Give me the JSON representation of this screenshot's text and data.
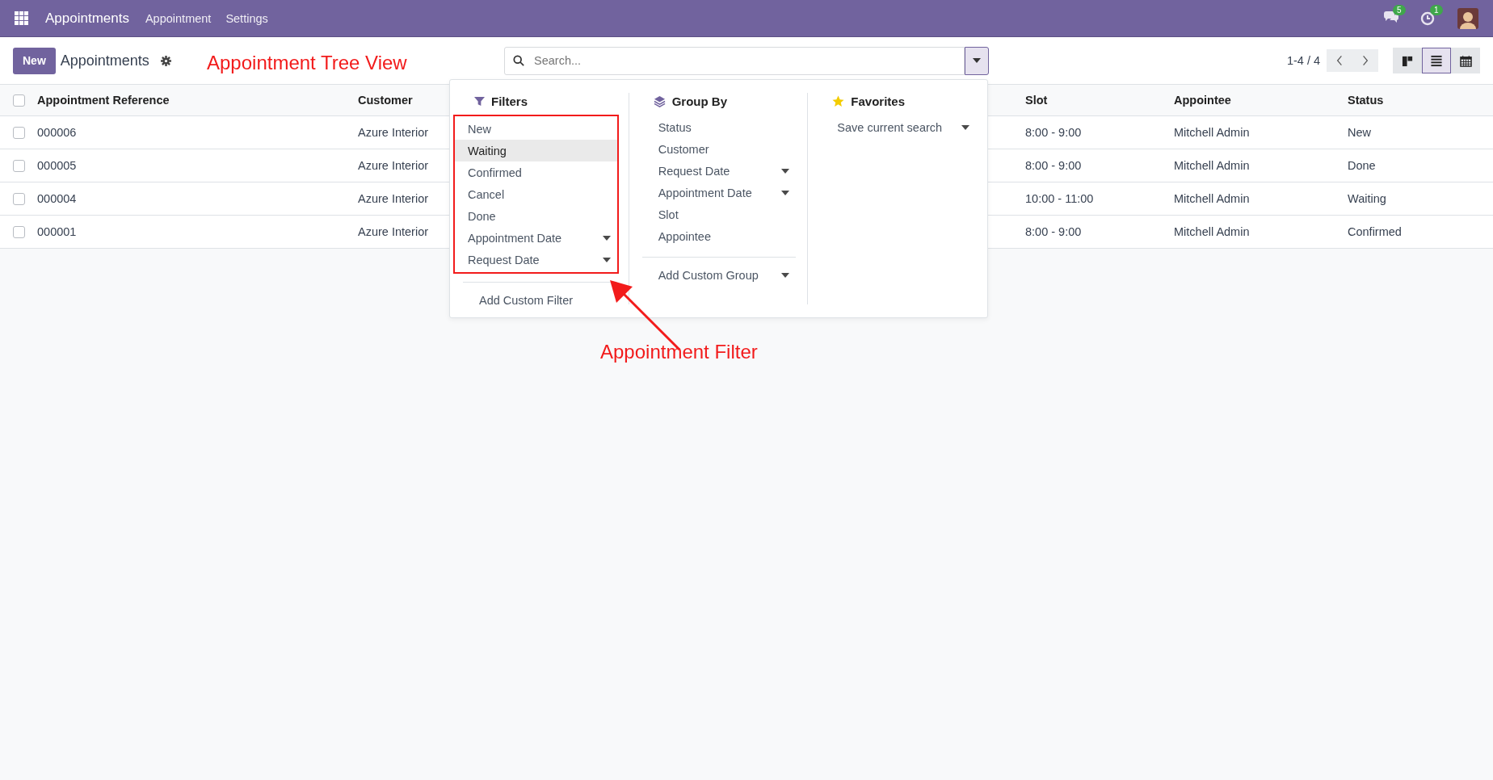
{
  "navbar": {
    "app_title": "Appointments",
    "menus": [
      "Appointment",
      "Settings"
    ],
    "message_count": "5",
    "activity_count": "1"
  },
  "control_panel": {
    "new_button": "New",
    "breadcrumb": "Appointments",
    "search": {
      "placeholder": "Search..."
    },
    "pager": "1-4 / 4",
    "views": [
      {
        "kind": "kanban",
        "selected": false
      },
      {
        "kind": "list",
        "selected": true
      },
      {
        "kind": "calendar",
        "selected": false
      }
    ]
  },
  "table": {
    "header_checked": false,
    "columns": [
      "Appointment Reference",
      "Customer",
      "Slot",
      "Appointee",
      "Status"
    ],
    "rows": [
      {
        "checked": false,
        "cells": [
          "000006",
          "Azure Interior",
          "8:00 - 9:00",
          "Mitchell Admin",
          "New"
        ]
      },
      {
        "checked": false,
        "cells": [
          "000005",
          "Azure Interior",
          "8:00 - 9:00",
          "Mitchell Admin",
          "Done"
        ]
      },
      {
        "checked": false,
        "cells": [
          "000004",
          "Azure Interior",
          "10:00 - 11:00",
          "Mitchell Admin",
          "Waiting"
        ]
      },
      {
        "checked": false,
        "cells": [
          "000001",
          "Azure Interior",
          "8:00 - 9:00",
          "Mitchell Admin",
          "Confirmed"
        ]
      }
    ]
  },
  "search_panel": {
    "filters": {
      "title": "Filters",
      "items": [
        {
          "label": "New",
          "highlighted": false,
          "kind": "option"
        },
        {
          "label": "Waiting",
          "highlighted": true,
          "kind": "option"
        },
        {
          "label": "Confirmed",
          "highlighted": false,
          "kind": "option"
        },
        {
          "label": "Cancel",
          "highlighted": false,
          "kind": "option"
        },
        {
          "label": "Done",
          "highlighted": false,
          "kind": "option"
        },
        {
          "label": "Appointment Date",
          "highlighted": false,
          "kind": "submenu"
        },
        {
          "label": "Request Date",
          "highlighted": false,
          "kind": "submenu"
        }
      ],
      "custom": {
        "label": "Add Custom Filter",
        "kind": "option"
      }
    },
    "group_by": {
      "title": "Group By",
      "items": [
        {
          "label": "Status",
          "highlighted": false,
          "kind": "option"
        },
        {
          "label": "Customer",
          "highlighted": false,
          "kind": "option"
        },
        {
          "label": "Request Date",
          "highlighted": false,
          "kind": "submenu"
        },
        {
          "label": "Appointment Date",
          "highlighted": false,
          "kind": "submenu"
        },
        {
          "label": "Slot",
          "highlighted": false,
          "kind": "option"
        },
        {
          "label": "Appointee",
          "highlighted": false,
          "kind": "option"
        }
      ],
      "custom": {
        "label": "Add Custom Group",
        "kind": "submenu"
      }
    },
    "favorites": {
      "title": "Favorites",
      "items": [
        {
          "label": "Save current search",
          "highlighted": false,
          "kind": "submenu"
        }
      ]
    }
  },
  "annotations": {
    "view_caption": "Appointment Tree View",
    "filter_caption": "Appointment Filter"
  }
}
